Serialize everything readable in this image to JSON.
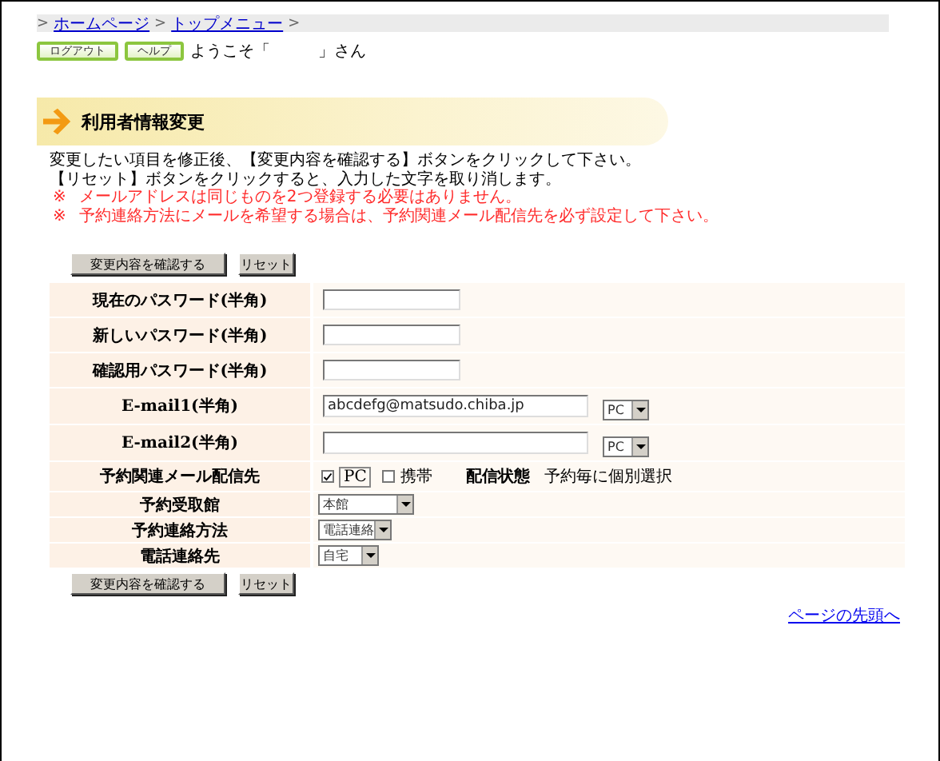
{
  "breadcrumb": [
    {
      "kind": "sep",
      "text": ">"
    },
    {
      "kind": "link",
      "text": "ホームページ"
    },
    {
      "kind": "sep",
      "text": ">"
    },
    {
      "kind": "link",
      "text": "トップメニュー"
    },
    {
      "kind": "sep",
      "text": ">"
    }
  ],
  "header_buttons": [
    "ログアウト",
    "ヘルプ"
  ],
  "welcome": {
    "open": "ようこそ「",
    "close": "」さん"
  },
  "title": "利用者情報変更",
  "instructions": [
    {
      "kind": "note",
      "text": "変更したい項目を修正後、【変更内容を確認する】ボタンをクリックして下さい。"
    },
    {
      "kind": "note",
      "text": "【リセット】ボタンをクリックすると、入力した文字を取り消します。"
    },
    {
      "kind": "warning",
      "mark": "※",
      "text": "メールアドレスは同じものを2つ登録する必要はありません。"
    },
    {
      "kind": "warning",
      "mark": "※",
      "text": "予約連絡方法にメールを希望する場合は、予約関連メール配信先を必ず設定して下さい。"
    }
  ],
  "top_buttons": [
    "変更内容を確認する",
    "リセット"
  ],
  "rows": [
    {
      "kind": "password",
      "label": "現在のパスワード(半角)"
    },
    {
      "kind": "password",
      "label": "新しいパスワード(半角)"
    },
    {
      "kind": "password",
      "label": "確認用パスワード(半角)"
    },
    {
      "kind": "email",
      "label": "E-mail1(半角)",
      "value": "abcdefg@matsudo.chiba.jp",
      "device": "PC"
    },
    {
      "kind": "email",
      "label": "E-mail2(半角)",
      "device": "PC"
    },
    {
      "kind": "delivery",
      "label": "予約関連メール配信先",
      "options": [
        {
          "label": "PC",
          "checked": true,
          "boxed": true
        },
        {
          "label": "携帯",
          "checked": false,
          "boxed": false
        }
      ],
      "status_label": "配信状態",
      "status_value": "予約毎に個別選択"
    },
    {
      "kind": "select",
      "label": "予約受取館",
      "value": "本館"
    },
    {
      "kind": "select",
      "label": "予約連絡方法",
      "value": "電話連絡"
    },
    {
      "kind": "select",
      "label": "電話連絡先",
      "value": "自宅"
    }
  ],
  "bottom_buttons": [
    "変更内容を確認する",
    "リセット"
  ],
  "page_top_link": "ページの先頭へ"
}
